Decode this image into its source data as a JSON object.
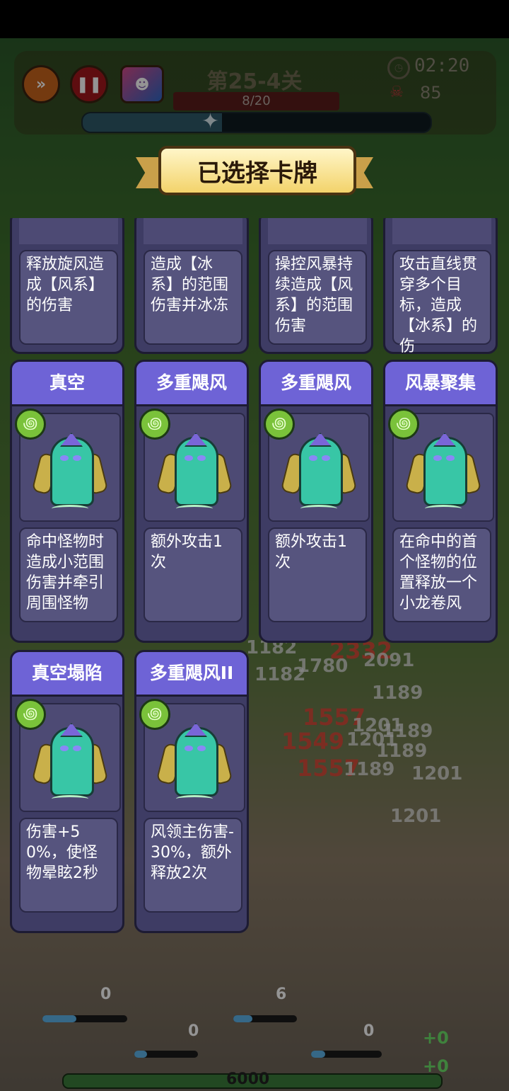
{
  "hud": {
    "speed_icon": "fast-forward-icon",
    "pause_icon": "pause-icon",
    "skill_icon": "skill-card-icon",
    "stage": "第25-4关",
    "wave": "8/20",
    "wave_progress": 0.4,
    "timer": "02:20",
    "kills": "85"
  },
  "banner": {
    "title": "已选择卡牌"
  },
  "top_row": [
    {
      "desc": "释放旋风造成【风系】的伤害"
    },
    {
      "desc": "造成【冰系】的范围伤害并冰冻"
    },
    {
      "desc": "操控风暴持续造成【风系】的范围伤害"
    },
    {
      "desc": "攻击直线贯穿多个目标，造成【冰系】的伤"
    }
  ],
  "cards": [
    {
      "title": "真空",
      "element_icon": "wind-element-icon",
      "desc": "命中怪物时造成小范围伤害并牵引周围怪物"
    },
    {
      "title": "多重飓风",
      "element_icon": "wind-element-icon",
      "desc": "额外攻击1次"
    },
    {
      "title": "多重飓风",
      "element_icon": "wind-element-icon",
      "desc": "额外攻击1次"
    },
    {
      "title": "风暴聚集",
      "element_icon": "wind-element-icon",
      "desc": "在命中的首个怪物的位置释放一个小龙卷风"
    },
    {
      "title": "真空塌陷",
      "element_icon": "wind-element-icon",
      "desc": "伤害+50%，使怪物晕眩2秒"
    },
    {
      "title": "多重飓风II",
      "element_icon": "wind-element-icon",
      "desc": "风领主伤害-30%，额外释放2次"
    }
  ],
  "background": {
    "damage_numbers": [
      "1182",
      "1780",
      "2332",
      "2091",
      "1182",
      "1189",
      "1557",
      "1201",
      "1189",
      "1549",
      "1201",
      "1189",
      "1557",
      "1189",
      "1201",
      "1201"
    ],
    "hero_levels": [
      "0",
      "6",
      "0",
      "0"
    ],
    "gold": "6000",
    "gains": [
      "+0",
      "+0"
    ]
  },
  "colors": {
    "card_title": "#6e63d6",
    "card_body": "#3e3c64",
    "banner": "#f3d36b",
    "wind": "#7ac23a"
  }
}
